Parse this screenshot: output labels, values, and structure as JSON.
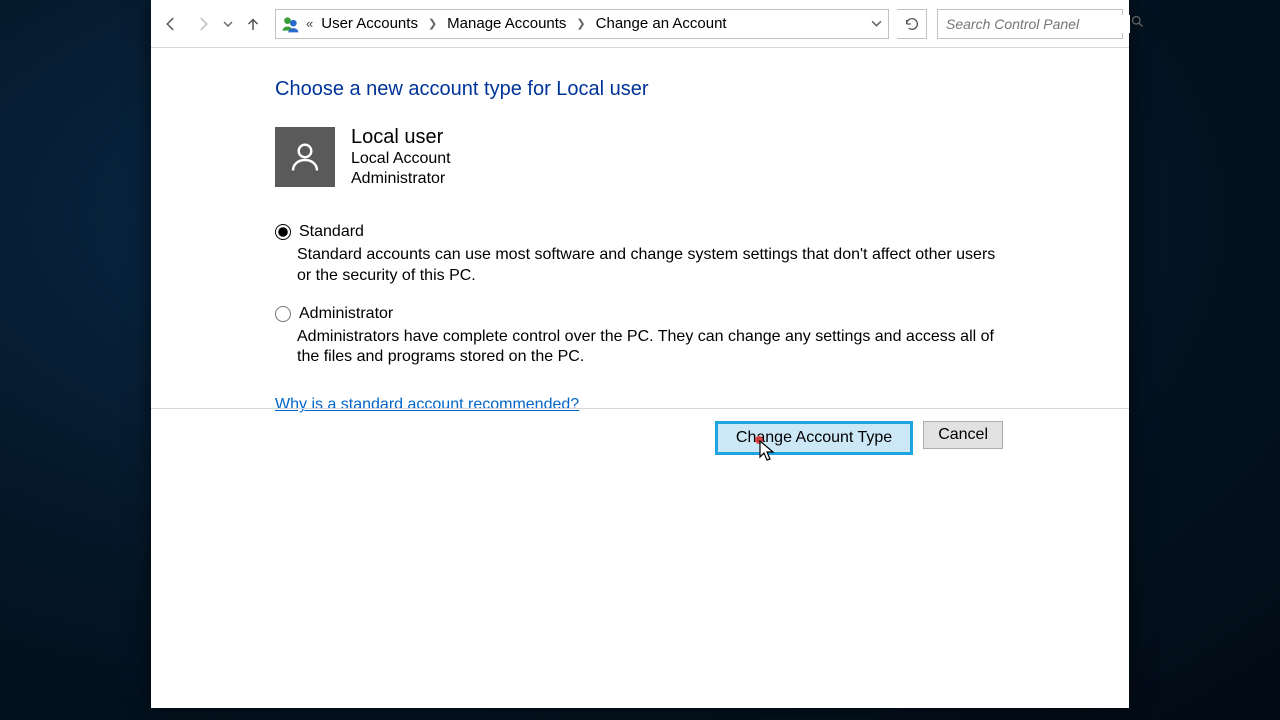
{
  "breadcrumbs": {
    "level1": "User Accounts",
    "level2": "Manage Accounts",
    "level3": "Change an Account"
  },
  "search": {
    "placeholder": "Search Control Panel"
  },
  "heading": "Choose a new account type for Local user",
  "user": {
    "name": "Local user",
    "accountType": "Local Account",
    "role": "Administrator"
  },
  "options": {
    "standard": {
      "label": "Standard",
      "desc": "Standard accounts can use most software and change system settings that don't affect other users or the security of this PC."
    },
    "administrator": {
      "label": "Administrator",
      "desc": "Administrators have complete control over the PC. They can change any settings and access all of the files and programs stored on the PC."
    },
    "selected": "standard"
  },
  "helpLink": "Why is a standard account recommended?",
  "buttons": {
    "confirm": "Change Account Type",
    "cancel": "Cancel"
  }
}
